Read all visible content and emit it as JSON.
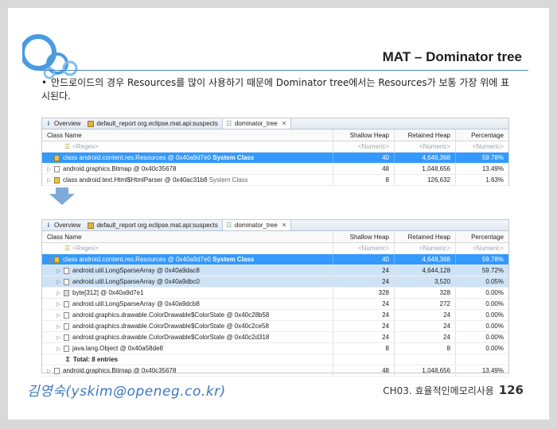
{
  "slide": {
    "title": "MAT – Dominator tree",
    "bullet": "•",
    "description": "안드로이드의 경우 Resources를 많이 사용하기 때문에 Dominator tree에서는 Resources가 보통 가장 위에 표시된다.",
    "signature": "김영숙(yskim@openeg.co.kr)",
    "footer_chapter": "CH03. 효율적인메모리사용",
    "footer_page": "126",
    "accent_color": "#4a87c5"
  },
  "tabs": {
    "overview": "Overview",
    "default_report": "default_report  org.eclipse.mat.api:suspects",
    "dominator_tree": "dominator_tree",
    "close": "✕"
  },
  "columns": {
    "class_name": "Class Name",
    "shallow_heap": "Shallow Heap",
    "retained_heap": "Retained Heap",
    "percentage": "Percentage"
  },
  "filters": {
    "regex": "<Regex>",
    "numeric": "<Numeric>"
  },
  "panel1_rows": [
    {
      "name": "class android.content.res.Resources @ 0x40a9d7e0",
      "suffix": "System Class",
      "shallow": "40",
      "retained": "4,648,368",
      "pct": "59.78%"
    },
    {
      "name": "android.graphics.Bitmap @ 0x40c35678",
      "suffix": "",
      "shallow": "48",
      "retained": "1,048,656",
      "pct": "13.49%"
    },
    {
      "name": "class android.text.Html$HtmlParser @ 0x40ac31b8",
      "suffix": "System Class",
      "shallow": "8",
      "retained": "126,632",
      "pct": "1.63%"
    }
  ],
  "panel2_rows": [
    {
      "name": "class android.content.res.Resources @ 0x40a9d7e0",
      "suffix": "System Class",
      "shallow": "40",
      "retained": "4,648,368",
      "pct": "59.78%"
    },
    {
      "name": "android.util.LongSparseArray @ 0x40a9dac8",
      "suffix": "",
      "shallow": "24",
      "retained": "4,644,128",
      "pct": "59.72%"
    },
    {
      "name": "android.util.LongSparseArray @ 0x40a9dbc0",
      "suffix": "",
      "shallow": "24",
      "retained": "3,520",
      "pct": "0.05%"
    },
    {
      "name": "byte[312] @ 0x40a9d7e1",
      "suffix": "",
      "shallow": "328",
      "retained": "328",
      "pct": "0.00%"
    },
    {
      "name": "android.util.LongSparseArray @ 0x40a9dcb8",
      "suffix": "",
      "shallow": "24",
      "retained": "272",
      "pct": "0.00%"
    },
    {
      "name": "android.graphics.drawable.ColorDrawable$ColorState @ 0x40c28b58",
      "suffix": "",
      "shallow": "24",
      "retained": "24",
      "pct": "0.00%"
    },
    {
      "name": "android.graphics.drawable.ColorDrawable$ColorState @ 0x40c2ce58",
      "suffix": "",
      "shallow": "24",
      "retained": "24",
      "pct": "0.00%"
    },
    {
      "name": "android.graphics.drawable.ColorDrawable$ColorState @ 0x40c2d318",
      "suffix": "",
      "shallow": "24",
      "retained": "24",
      "pct": "0.00%"
    },
    {
      "name": "java.lang.Object @ 0x40a58de8",
      "suffix": "",
      "shallow": "8",
      "retained": "8",
      "pct": "0.00%"
    },
    {
      "name": "Total: 8 entries",
      "suffix": "",
      "shallow": "",
      "retained": "",
      "pct": ""
    },
    {
      "name": "android.graphics.Bitmap @ 0x40c35678",
      "suffix": "",
      "shallow": "48",
      "retained": "1,048,656",
      "pct": "13.49%"
    }
  ],
  "total_symbol": "Σ"
}
